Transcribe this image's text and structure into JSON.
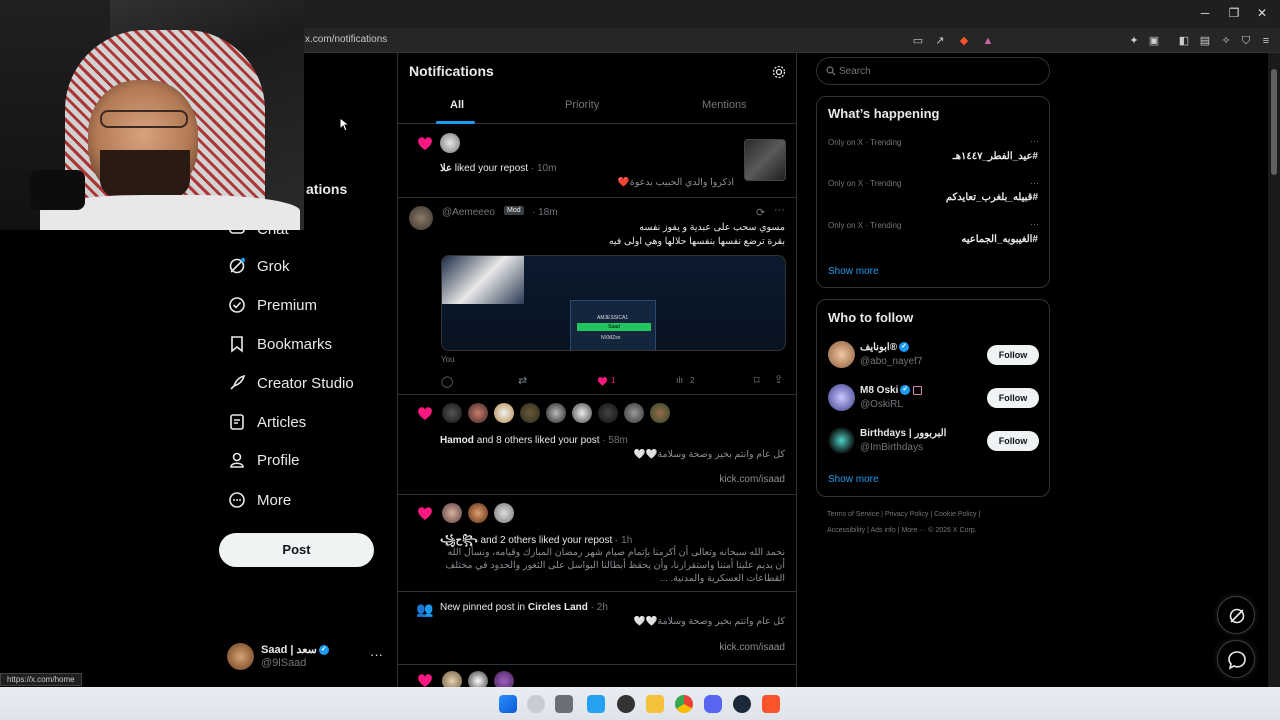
{
  "browser": {
    "url": "x.com/notifications",
    "status_url": "https://x.com/home"
  },
  "nav": {
    "partial_item": "ations",
    "items": [
      {
        "label": "Chat",
        "icon": "chat-icon"
      },
      {
        "label": "Grok",
        "icon": "grok-icon"
      },
      {
        "label": "Premium",
        "icon": "premium-icon"
      },
      {
        "label": "Bookmarks",
        "icon": "bookmark-icon"
      },
      {
        "label": "Creator Studio",
        "icon": "rocket-icon"
      },
      {
        "label": "Articles",
        "icon": "article-icon"
      },
      {
        "label": "Profile",
        "icon": "profile-icon"
      },
      {
        "label": "More",
        "icon": "more-icon"
      }
    ],
    "post_label": "Post",
    "account": {
      "name": "Saad | سعد",
      "handle": "@9lSaad"
    }
  },
  "notifications": {
    "title": "Notifications",
    "tabs": [
      "All",
      "Priority",
      "Mentions"
    ],
    "n1": {
      "actor": "علا",
      "action": "liked your repost",
      "time": "· 10m",
      "text": "اذكروا والدي الحبيب بدعوة❤️"
    },
    "post": {
      "handle": "@Aemeeeo",
      "badge": "Mod",
      "time": "· 18m",
      "line1": "مسوي سحب على عبدية و يفوز نفسه",
      "line2": "بقرة ترضع نفسها بنفسها حلالها وهي اولى فيه",
      "you": "You",
      "likes": "1",
      "views": "2",
      "card_lines": [
        "AMJESSICA1",
        "Saad",
        "NXMZsn"
      ]
    },
    "n3": {
      "actor": "Hamod",
      "action": "and 8 others liked your post",
      "time": "· 58m",
      "text": "كل عام وانتم بخير وصحة وسلامة🤍🤍",
      "link": "kick.com/isaad"
    },
    "n4": {
      "actor": "꧁ح꧂",
      "action": "and 2 others liked your repost",
      "time": "· 1h",
      "lines": [
        "نحمد الله سبحانه وتعالى أن أكرمنا بإتمام صيام شهر رمضان المبارك وقيامه، ونسأل الله",
        "أن يديم علينا أمننا واستقرارنا، وأن يحفظ أبطالنا البواسل على الثغور والحدود في مختلف",
        "القطاعات العسكرية والمدنية. ..."
      ]
    },
    "n5": {
      "prefix": "New pinned post in",
      "community": "Circles Land",
      "time": "· 2h",
      "text": "كل عام وانتم بخير وصحة وسلامة🤍🤍",
      "link": "kick.com/isaad"
    }
  },
  "search": {
    "placeholder": "Search"
  },
  "trends": {
    "title": "What’s happening",
    "items": [
      {
        "meta": "Only on X · Trending",
        "tag": "#عيد_الفطر_١٤٤٧هـ"
      },
      {
        "meta": "Only on X · Trending",
        "tag": "#قبيله_بلغرب_تعايدكم"
      },
      {
        "meta": "Only on X · Trending",
        "tag": "#الغيبوبه_الجماعيه"
      }
    ],
    "show_more": "Show more"
  },
  "who_to_follow": {
    "title": "Who to follow",
    "items": [
      {
        "name": "ابونايف®",
        "handle": "@abo_nayef7",
        "button": "Follow"
      },
      {
        "name": "M8 Oski",
        "handle": "@OskiRL",
        "button": "Follow"
      },
      {
        "name": "Birthdays | البربوور",
        "handle": "@ImBirthdays",
        "button": "Follow"
      }
    ],
    "show_more": "Show more"
  },
  "footer": {
    "row1": "Terms of Service  |   Privacy Policy  |   Cookie Policy  |",
    "row2": "Accessibility  |   Ads info  |   More ···   © 2026 X Corp."
  },
  "colors": {
    "accent": "#1d9bf0",
    "like": "#f91880",
    "bg": "#000000",
    "border": "#2f3336"
  }
}
